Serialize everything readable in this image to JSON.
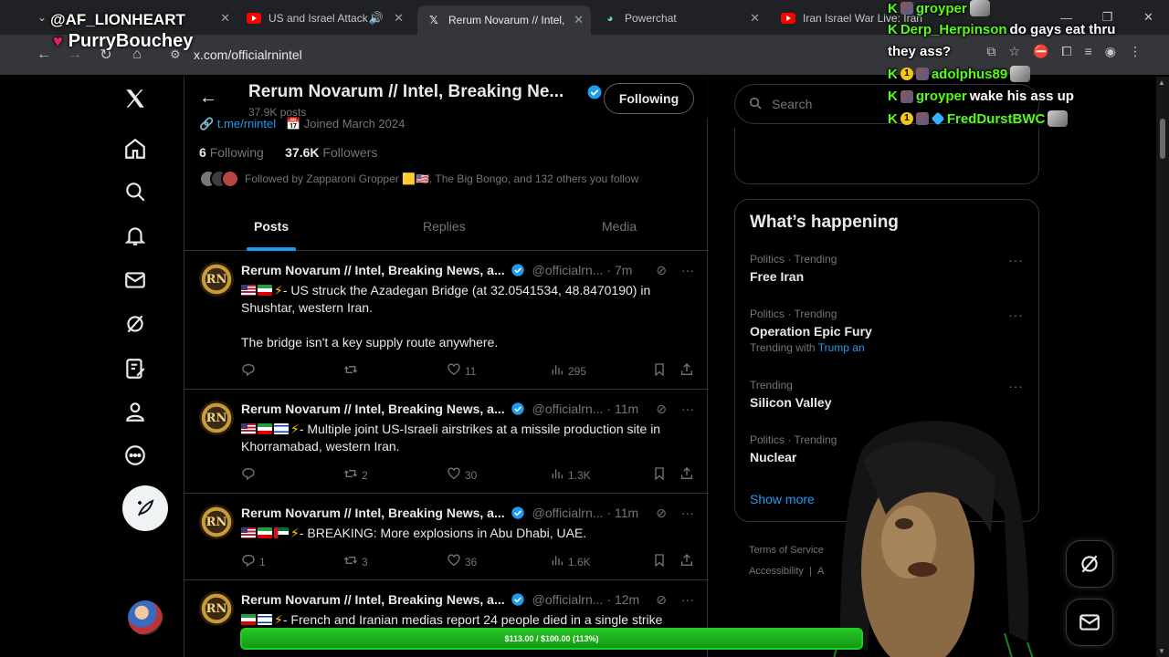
{
  "browser": {
    "tabs": [
      {
        "title": "",
        "icon": "kick-icon",
        "active": false
      },
      {
        "title": "US and Israel Attack",
        "icon": "youtube-icon",
        "active": false,
        "audio": true
      },
      {
        "title": "Rerum Novarum // Intel,",
        "icon": "x-icon",
        "active": true
      },
      {
        "title": "Powerchat",
        "icon": "powerchat-icon",
        "active": false
      },
      {
        "title": "Iran Israel War Live: Iran",
        "icon": "youtube-icon",
        "active": false
      }
    ],
    "url": "x.com/officialrnintel"
  },
  "profile": {
    "name": "Rerum Novarum // Intel, Breaking Ne...",
    "posts_count": "37.9K posts",
    "follow_button": "Following",
    "link": "t.me/rnintel",
    "joined": "Joined March 2024",
    "following_count": "6",
    "following_label": "Following",
    "followers_count": "37.6K",
    "followers_label": "Followers",
    "followed_by": "Followed by Zapparoni Gropper 🟨🇺🇸, The Big Bongo, and 132 others you follow"
  },
  "tabs": [
    "Posts",
    "Replies",
    "Media"
  ],
  "tweets": [
    {
      "name": "Rerum Novarum // Intel, Breaking News, a...",
      "handle": "@officialrn...",
      "time": "· 7m",
      "flags": [
        "us",
        "ir"
      ],
      "text": "- US struck the Azadegan Bridge (at 32.0541534, 48.8470190) in Shushtar, western Iran.\n\nThe bridge isn't a key supply route anywhere.",
      "replies": "",
      "reposts": "",
      "likes": "11",
      "views": "295"
    },
    {
      "name": "Rerum Novarum // Intel, Breaking News, a...",
      "handle": "@officialrn...",
      "time": "· 11m",
      "flags": [
        "us",
        "ir",
        "il"
      ],
      "text": "- Multiple joint US-Israeli airstrikes at a missile production site in Khorramabad, western Iran.",
      "replies": "",
      "reposts": "2",
      "likes": "30",
      "views": "1.3K"
    },
    {
      "name": "Rerum Novarum // Intel, Breaking News, a...",
      "handle": "@officialrn...",
      "time": "· 11m",
      "flags": [
        "us",
        "ir",
        "ae"
      ],
      "text": "- BREAKING: More explosions in Abu Dhabi, UAE.",
      "replies": "1",
      "reposts": "3",
      "likes": "36",
      "views": "1.6K"
    },
    {
      "name": "Rerum Novarum // Intel, Breaking News, a...",
      "handle": "@officialrn...",
      "time": "· 12m",
      "flags": [
        "ir",
        "il"
      ],
      "text": "- French and Iranian medias report 24 people died in a single strike",
      "replies": "",
      "reposts": "",
      "likes": "",
      "views": ""
    }
  ],
  "sidebar": {
    "search_placeholder": "Search",
    "happening_title": "What’s happening",
    "trends": [
      {
        "context": "Politics · Trending",
        "topic": "Free Iran",
        "with": ""
      },
      {
        "context": "Politics · Trending",
        "topic": "Operation Epic Fury",
        "with": "Trending with",
        "with_link": "Trump an"
      },
      {
        "context": "Trending",
        "topic": "Silicon Valley",
        "with": ""
      },
      {
        "context": "Politics · Trending",
        "topic": "Nuclear",
        "with": ""
      }
    ],
    "show_more": "Show more",
    "footer_links": [
      "Terms of Service",
      "Accessibility",
      "A"
    ]
  },
  "overlay": {
    "streamer_line1": "@AF_LIONHEART",
    "streamer_line2": "PurryBouchey",
    "chat": [
      {
        "user": "groyper",
        "message": ""
      },
      {
        "user": "Derp_Herpinson",
        "message": "do gays eat thru"
      },
      {
        "user": "",
        "message": "they ass?"
      },
      {
        "user": "adolphus89",
        "message": ""
      },
      {
        "user": "groyper",
        "message": "wake his ass up"
      },
      {
        "user": "FredDurstBWC",
        "message": ""
      }
    ],
    "goal_text": "$113.00 / $100.00 (113%)",
    "goal_fraction": 1.0
  },
  "colors": {
    "accent": "#1d9bf0",
    "kick_green": "#53fc18",
    "goal_green": "#1fd01f"
  }
}
